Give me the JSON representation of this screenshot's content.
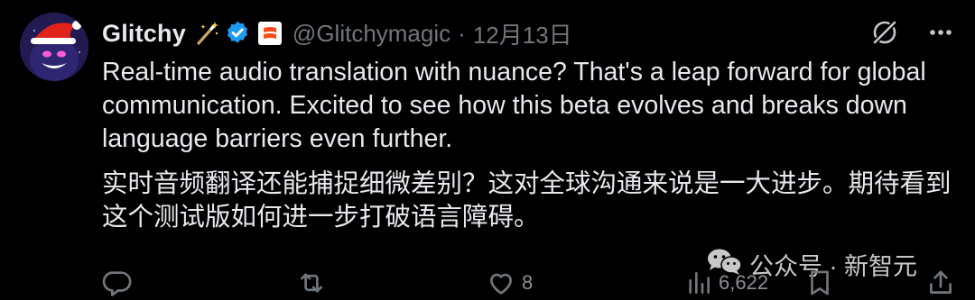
{
  "post": {
    "author_name": "Glitchy",
    "handle": "@Glitchymagic",
    "separator": "·",
    "date": "12月13日",
    "body_en": "Real-time audio translation with nuance? That's a leap forward for global communication. Excited to see how this beta evolves and breaks down language barriers even further.",
    "body_zh": "实时音频翻译还能捕捉细微差别？这对全球沟通来说是一大进步。期待看到这个测试版如何进一步打破语言障碍。"
  },
  "header_icons": [
    "magic-wand-icon",
    "verified-badge-icon",
    "affiliate-badge-icon",
    "grok-icon",
    "more-icon"
  ],
  "actions": {
    "reply": {
      "icon": "reply-icon",
      "count": ""
    },
    "repost": {
      "icon": "repost-icon",
      "count": ""
    },
    "like": {
      "icon": "heart-icon",
      "count": "8"
    },
    "views": {
      "icon": "views-icon",
      "count": "6,622"
    },
    "bookmark": {
      "icon": "bookmark-icon"
    },
    "share": {
      "icon": "share-icon"
    }
  },
  "watermark": {
    "text": "公众号 · 新智元",
    "icon": "wechat-icon"
  },
  "colors": {
    "background": "#000000",
    "text": "#e7e9ea",
    "muted": "#71767b",
    "verified": "#1d9bf0",
    "affiliate": "#ff4a1c"
  }
}
